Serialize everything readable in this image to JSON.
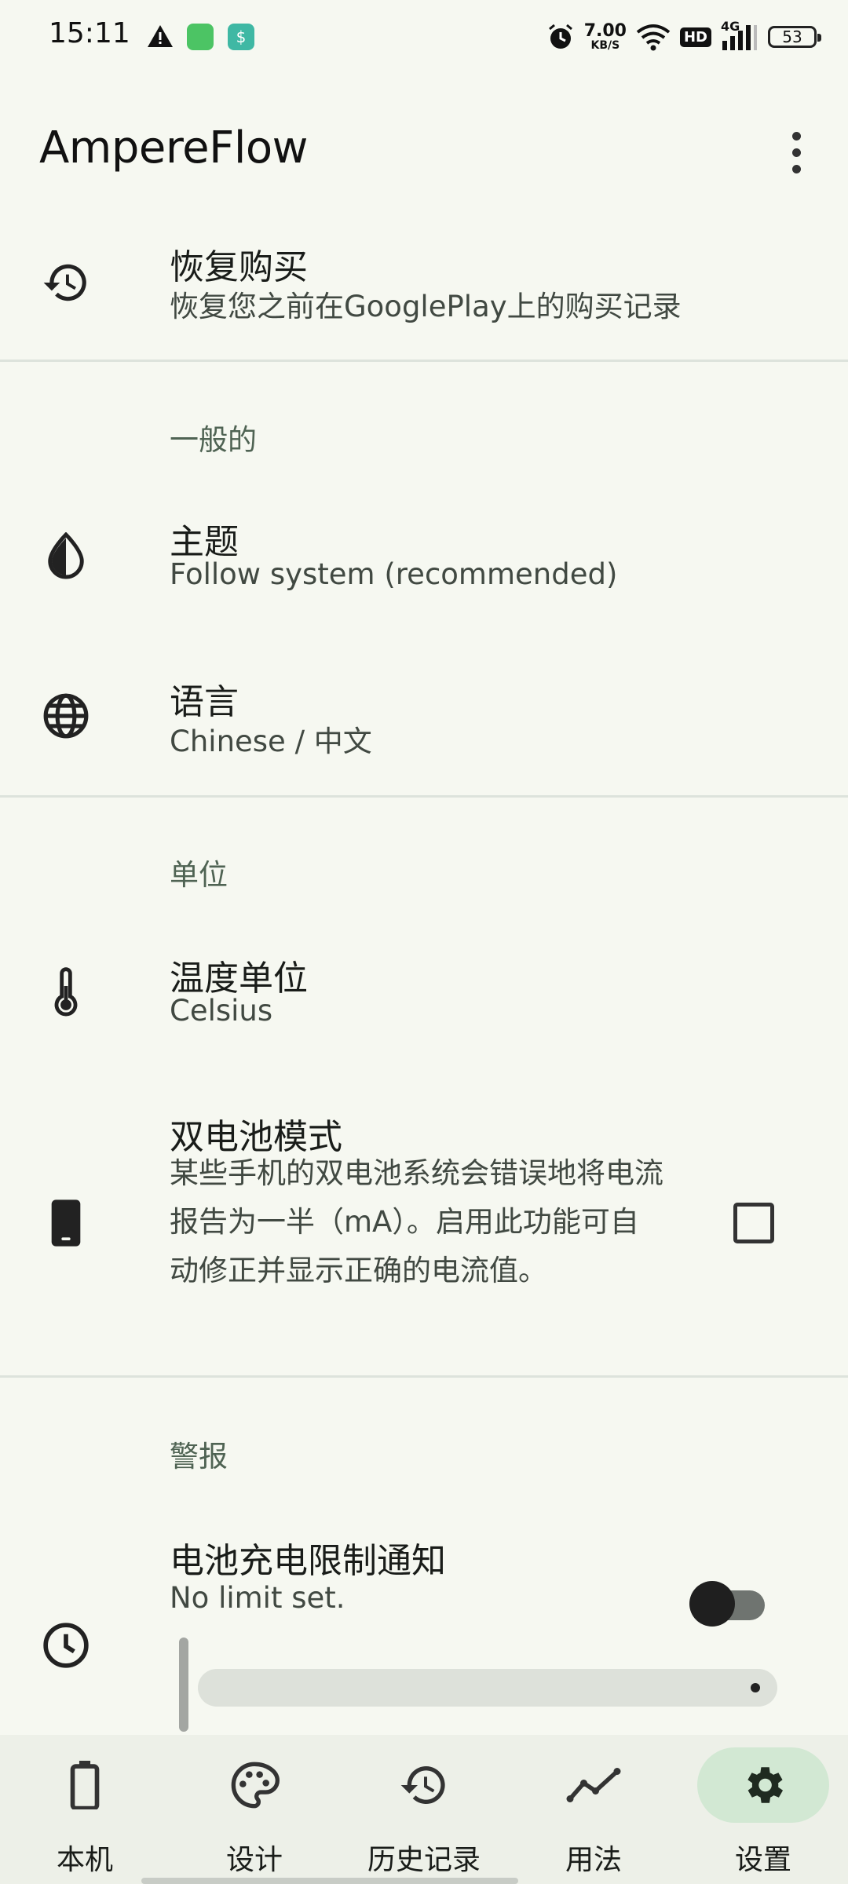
{
  "status_bar": {
    "time": "15:11",
    "net_speed_value": "7.00",
    "net_speed_unit": "KB/S",
    "hd": "HD",
    "network": "4G",
    "battery": "53",
    "icons": [
      "warning-icon",
      "messages-app-icon",
      "security-app-icon",
      "alarm-icon",
      "wifi-icon",
      "signal-icon"
    ]
  },
  "app_bar": {
    "title": "AmpereFlow",
    "menu_icon": "more-vertical-icon"
  },
  "settings": {
    "restore": {
      "title": "恢复购买",
      "summary": "恢复您之前在GooglePlay上的购买记录",
      "icon": "restore-history-icon"
    },
    "general_header": "一般的",
    "theme": {
      "title": "主题",
      "summary": "Follow system (recommended)",
      "icon": "theme-drop-icon"
    },
    "language": {
      "title": "语言",
      "summary": "Chinese / 中文",
      "icon": "globe-icon"
    },
    "units_header": "单位",
    "temp_unit": {
      "title": "温度单位",
      "summary": "Celsius",
      "icon": "thermometer-icon"
    },
    "dual_battery": {
      "title": "双电池模式",
      "summary": "某些手机的双电池系统会错误地将电流报告为一半（mA）。启用此功能可自动修正并显示正确的电流值。",
      "icon": "phone-icon",
      "checked": false
    },
    "alerts_header": "警报",
    "charge_limit": {
      "title": "电池充电限制通知",
      "summary": "No limit set.",
      "icon": "clock-icon",
      "enabled": false
    }
  },
  "bottom_nav": {
    "items": [
      {
        "label": "本机",
        "icon": "battery-icon"
      },
      {
        "label": "设计",
        "icon": "palette-icon"
      },
      {
        "label": "历史记录",
        "icon": "history-icon"
      },
      {
        "label": "用法",
        "icon": "usage-chart-icon"
      },
      {
        "label": "设置",
        "icon": "settings-gear-icon"
      }
    ],
    "active_index": 4
  },
  "colors": {
    "background": "#f6f8f1",
    "nav_background": "#edf0e8",
    "active_pill": "#d2e8d3",
    "section_header": "#4f6353"
  }
}
